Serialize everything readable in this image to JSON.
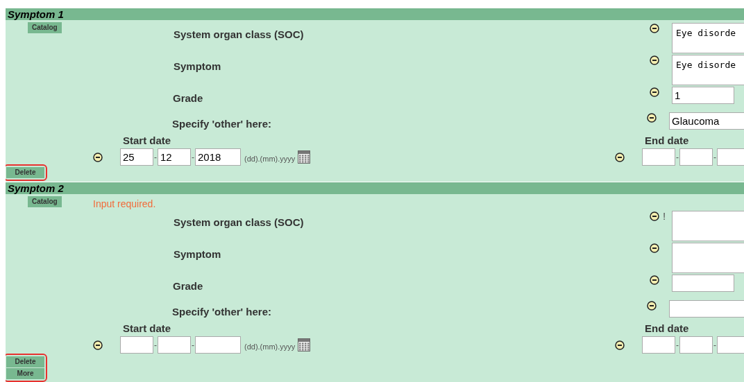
{
  "sections": [
    {
      "title": "Symptom 1",
      "catalog_button": "Catalog",
      "fields": [
        {
          "kind": "textarea",
          "label": "System organ class (SOC)",
          "value": "Eye disorde"
        },
        {
          "kind": "textarea",
          "label": "Symptom",
          "value": "Eye disorde"
        },
        {
          "kind": "short",
          "label": "Grade",
          "value": "1"
        },
        {
          "kind": "wide",
          "label": "Specify 'other' here:",
          "value": "Glaucoma"
        }
      ],
      "start_date": {
        "label": "Start date",
        "day": "25",
        "month": "12",
        "year": "2018",
        "separators": [
          "-",
          "-"
        ],
        "format": "(dd).(mm).yyyy"
      },
      "end_date": {
        "label": "End date",
        "separators": [
          "-",
          "-"
        ]
      },
      "buttons": [
        "Delete"
      ]
    },
    {
      "title": "Symptom 2",
      "catalog_button": "Catalog",
      "message": "Input required.",
      "fields": [
        {
          "kind": "textarea",
          "label": "System organ class (SOC)",
          "required_mark": "!"
        },
        {
          "kind": "textarea",
          "label": "Symptom"
        },
        {
          "kind": "short",
          "label": "Grade"
        },
        {
          "kind": "wide",
          "label": "Specify 'other' here:"
        }
      ],
      "start_date": {
        "label": "Start date",
        "separators": [
          "-",
          "-"
        ],
        "format": "(dd).(mm).yyyy"
      },
      "end_date": {
        "label": "End date",
        "separators": [
          "-",
          "-"
        ]
      },
      "buttons": [
        "Delete",
        "More"
      ]
    }
  ]
}
